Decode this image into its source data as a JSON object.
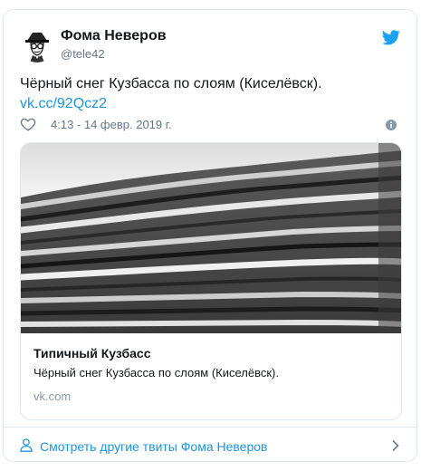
{
  "author": {
    "name": "Фома Неверов",
    "handle": "@tele42",
    "avatar_icon": "sketch-portrait-avatar"
  },
  "tweet": {
    "text": "Чёрный снег Кузбасса по слоям (Киселёвск).",
    "link": "vk.cc/92Qcz2",
    "timestamp": "4:13 - 14 февр. 2019 г."
  },
  "icons": {
    "brand": "twitter-bird-icon",
    "like": "heart-icon",
    "info": "info-icon",
    "footer": "user-icon",
    "footer_arrow": "chevron-right-icon"
  },
  "link_card": {
    "title": "Типичный Кузбасс",
    "description": "Чёрный снег Кузбасса по слоям (Киселёвск).",
    "domain": "vk.com"
  },
  "footer": {
    "label": "Смотреть другие твиты Фома Неверов"
  },
  "colors": {
    "accent": "#1b95e0",
    "muted": "#657786",
    "border": "#e1e8ed"
  }
}
